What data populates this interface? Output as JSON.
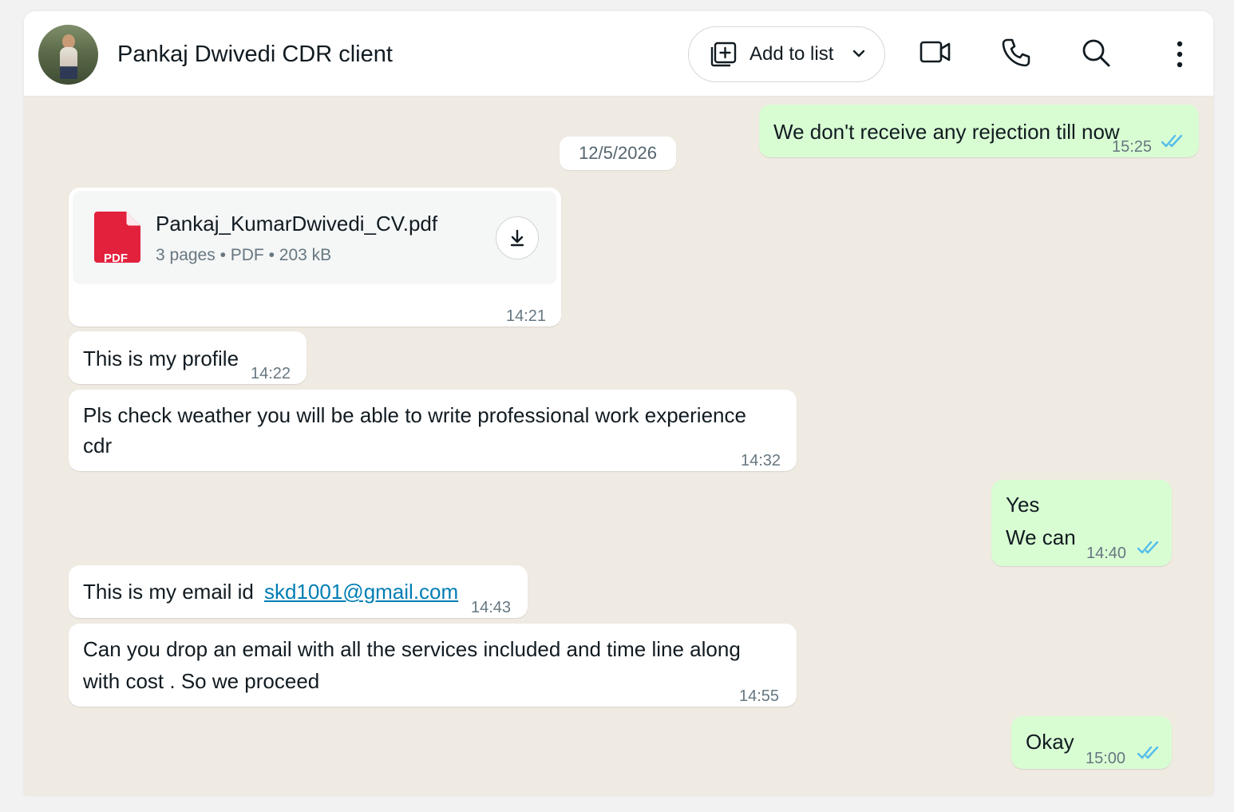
{
  "header": {
    "contact_name": "Pankaj Dwivedi CDR client",
    "add_to_list_label": "Add to list",
    "icons": [
      "video-call-icon",
      "voice-call-icon",
      "search-icon",
      "menu-icon"
    ]
  },
  "chat": {
    "date_separator": "12/5/2026",
    "messages": [
      {
        "direction": "out",
        "text": "We don't receive any rejection till now",
        "time": "15:25",
        "status": "read"
      },
      {
        "direction": "in",
        "type": "document",
        "file_name": "Pankaj_KumarDwivedi_CV.pdf",
        "file_meta": "3 pages • PDF • 203 kB",
        "file_badge": "PDF",
        "time": "14:21"
      },
      {
        "direction": "in",
        "text": "This is my profile",
        "time": "14:22"
      },
      {
        "direction": "in",
        "text_line1": "Pls check weather you will be able to write professional work experience",
        "text_line2": "cdr",
        "time": "14:32"
      },
      {
        "direction": "out",
        "text_line1": "Yes",
        "text_line2": "We can",
        "time": "14:40",
        "status": "read"
      },
      {
        "direction": "in",
        "text": "This is my email id",
        "link": "skd1001@gmail.com",
        "time": "14:43"
      },
      {
        "direction": "in",
        "text_line1": "Can you drop an email with all the services included and time line along",
        "text_line2": "with cost . So we proceed",
        "time": "14:55"
      },
      {
        "direction": "out",
        "text": "Okay",
        "time": "15:00",
        "status": "read"
      }
    ]
  },
  "colors": {
    "outgoing_bubble": "#d9fdd3",
    "incoming_bubble": "#ffffff",
    "chat_background": "#efeae2",
    "read_ticks": "#53bdeb",
    "pdf_red": "#e2213c",
    "link": "#027eb5"
  }
}
